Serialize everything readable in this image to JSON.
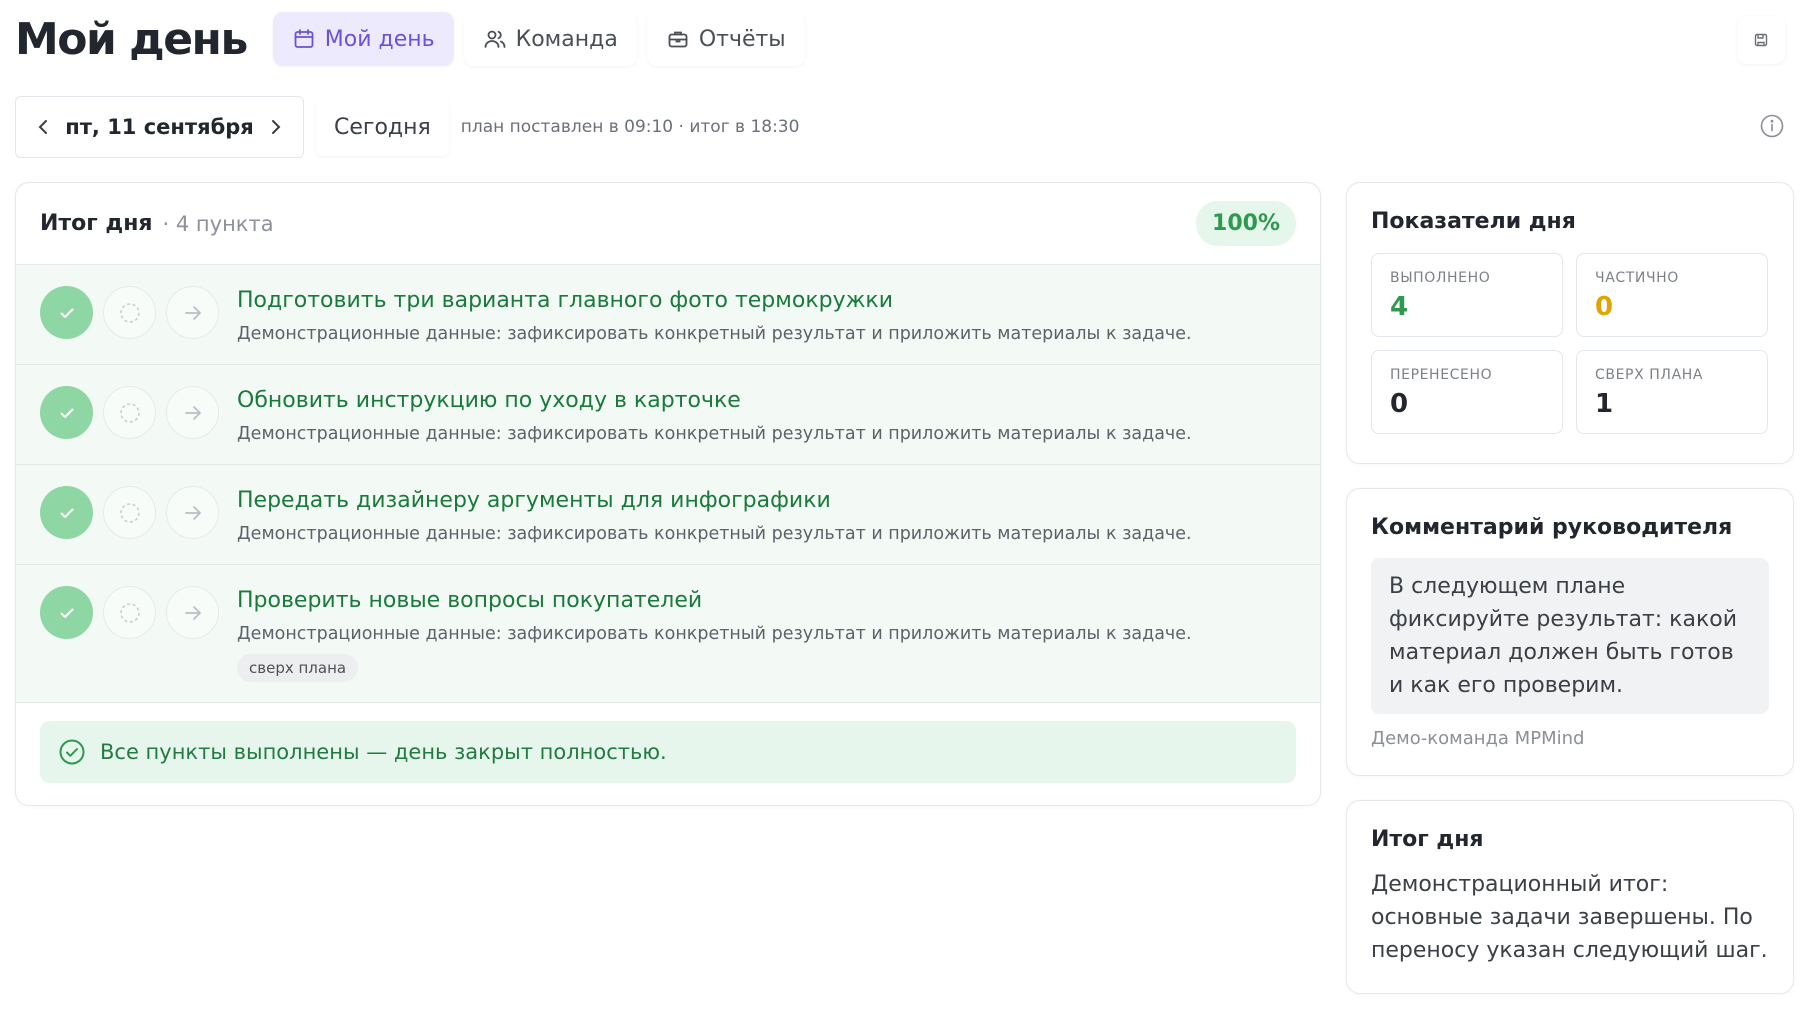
{
  "header": {
    "title": "Мой день",
    "tabs": [
      {
        "label": "Мой день",
        "icon": "calendar-icon",
        "active": true
      },
      {
        "label": "Команда",
        "icon": "users-icon",
        "active": false
      },
      {
        "label": "Отчёты",
        "icon": "briefcase-icon",
        "active": false
      }
    ],
    "corner_icon": "save-icon"
  },
  "date_bar": {
    "date": "пт, 11 сентября",
    "today_label": "Сегодня",
    "plan_meta": "план поставлен в 09:10 · итог в 18:30",
    "info_icon": "info-icon"
  },
  "day_result": {
    "title": "Итог дня",
    "count": "· 4 пункта",
    "percent": "100%",
    "tasks": [
      {
        "title": "Подготовить три варианта главного фото термокружки",
        "desc": "Демонстрационные данные: зафиксировать конкретный результат и приложить материалы к задаче.",
        "status": "done"
      },
      {
        "title": "Обновить инструкцию по уходу в карточке",
        "desc": "Демонстрационные данные: зафиксировать конкретный результат и приложить материалы к задаче.",
        "status": "done"
      },
      {
        "title": "Передать дизайнеру аргументы для инфографики",
        "desc": "Демонстрационные данные: зафиксировать конкретный результат и приложить материалы к задаче.",
        "status": "done"
      },
      {
        "title": "Проверить новые вопросы покупателей",
        "desc": "Демонстрационные данные: зафиксировать конкретный результат и приложить материалы к задаче.",
        "status": "done",
        "tag": "сверх плана"
      }
    ],
    "banner": "Все пункты выполнены — день закрыт полностью."
  },
  "metrics": {
    "title": "Показатели дня",
    "items": [
      {
        "label": "ВЫПОЛНЕНО",
        "value": "4",
        "color": "#2e9a4f"
      },
      {
        "label": "ЧАСТИЧНО",
        "value": "0",
        "color": "#e0a500"
      },
      {
        "label": "ПЕРЕНЕСЕНО",
        "value": "0",
        "color": "#22262e"
      },
      {
        "label": "СВЕРХ ПЛАНА",
        "value": "1",
        "color": "#22262e"
      }
    ]
  },
  "comment": {
    "title": "Комментарий руководителя",
    "text": "В следующем плане фиксируйте результат: какой материал должен быть готов и как его проверим.",
    "author": "Демо-команда MPMind"
  },
  "summary": {
    "title": "Итог дня",
    "text": "Демонстрационный итог: основные задачи завершены. По переносу указан следующий шаг."
  },
  "colors": {
    "accent": "#6b52d6",
    "success": "#2e9a4f",
    "success_bg": "#f3faf5",
    "warning": "#e0a500"
  }
}
